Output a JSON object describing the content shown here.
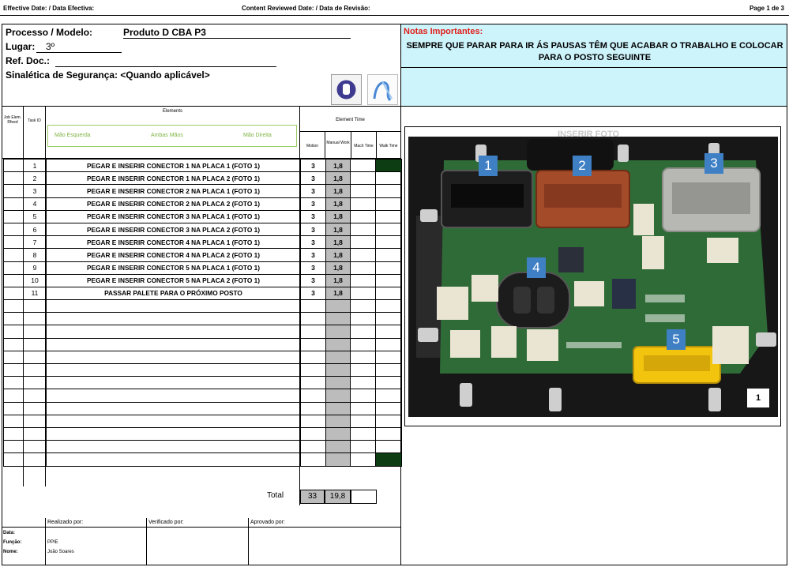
{
  "header": {
    "effective_date": "Effective Date: / Data Efectiva:",
    "content_reviewed": "Content Reviewed Date: / Data de Revisão:",
    "page": "Page 1 de 3"
  },
  "info": {
    "process_label": "Processo / Modelo:",
    "process_value": "Produto D CBA P3",
    "place_label": "Lugar:",
    "place_value": "3º",
    "ref_label": "Ref. Doc.:",
    "safety_label": "Sinalética de Segurança: <Quando aplicável>"
  },
  "notes": {
    "title": "Notas Importantes:",
    "text": "SEMPRE QUE PARAR PARA IR ÁS PAUSAS TÊM QUE ACABAR O TRABALHO E COLOCAR PARA O POSTO SEGUINTE"
  },
  "table_head": {
    "job_elem": "Job Elem. Rfeed",
    "task_id": "Task ID",
    "elements": "Elements",
    "left_hand": "Mão Esquerda",
    "both_hands": "Ambas Mãos",
    "right_hand": "Mão Direita",
    "element_time": "Element Time",
    "motion": "Motion",
    "manual_work": "Manual Work",
    "mach_time": "Mach Time",
    "walk_time": "Walk Time"
  },
  "steps": [
    {
      "id": "1",
      "desc": "PEGAR E INSERIR CONECTOR 1 NA PLACA 1 (FOTO 1)",
      "motion": "3",
      "manual": "1,8"
    },
    {
      "id": "2",
      "desc": "PEGAR E INSERIR CONECTOR 1 NA PLACA 2 (FOTO 1)",
      "motion": "3",
      "manual": "1,8"
    },
    {
      "id": "3",
      "desc": "PEGAR E INSERIR CONECTOR 2 NA PLACA 1 (FOTO 1)",
      "motion": "3",
      "manual": "1,8"
    },
    {
      "id": "4",
      "desc": "PEGAR E INSERIR CONECTOR 2 NA PLACA 2 (FOTO 1)",
      "motion": "3",
      "manual": "1,8"
    },
    {
      "id": "5",
      "desc": "PEGAR E INSERIR CONECTOR 3 NA PLACA 1 (FOTO 1)",
      "motion": "3",
      "manual": "1,8"
    },
    {
      "id": "6",
      "desc": "PEGAR E INSERIR CONECTOR 3 NA PLACA 2 (FOTO 1)",
      "motion": "3",
      "manual": "1,8"
    },
    {
      "id": "7",
      "desc": "PEGAR E INSERIR CONECTOR 4 NA PLACA 1 (FOTO 1)",
      "motion": "3",
      "manual": "1,8"
    },
    {
      "id": "8",
      "desc": "PEGAR E INSERIR CONECTOR 4 NA PLACA 2 (FOTO 1)",
      "motion": "3",
      "manual": "1,8"
    },
    {
      "id": "9",
      "desc": "PEGAR E INSERIR CONECTOR 5 NA PLACA 1 (FOTO 1)",
      "motion": "3",
      "manual": "1,8"
    },
    {
      "id": "10",
      "desc": "PEGAR E INSERIR CONECTOR 5 NA PLACA 2 (FOTO 1)",
      "motion": "3",
      "manual": "1,8"
    },
    {
      "id": "11",
      "desc": "PASSAR PALETE PARA O PRÓXIMO POSTO",
      "motion": "3",
      "manual": "1,8"
    }
  ],
  "totals": {
    "label": "Total",
    "motion": "33",
    "manual": "19,8"
  },
  "signoff": {
    "made_by": "Realizado por:",
    "verified_by": "Verificado por:",
    "approved_by": "Aprovado por:",
    "date_label": "Data:",
    "function_label": "Função:",
    "name_label": "Nome:",
    "function_value": "PPIE",
    "name_value": "João Soares"
  },
  "photo": {
    "placeholder": "INSERIR FOTO",
    "photo_number": "1",
    "markers": [
      "1",
      "2",
      "3",
      "4",
      "5"
    ]
  },
  "colors": {
    "notes_bg": "#cdf3fb",
    "notes_title": "#e0201a",
    "walk_fill": "#0d3d12",
    "pcb": "#2f6b37",
    "marker": "#3f80c5"
  }
}
